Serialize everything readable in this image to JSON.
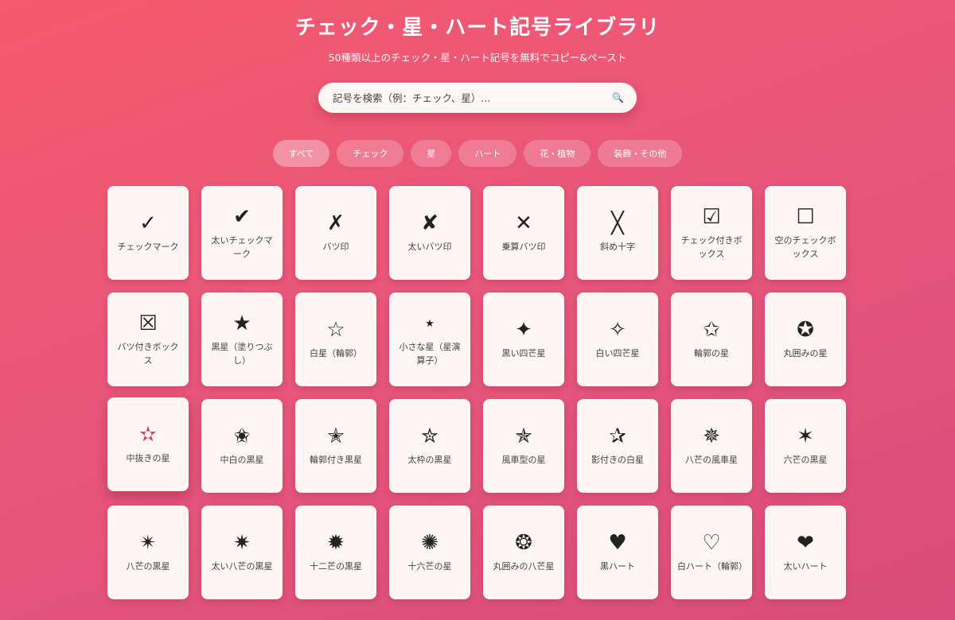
{
  "header": {
    "title": "チェック・星・ハート記号ライブラリ",
    "subtitle": "50種類以上のチェック・星・ハート記号を無料でコピー&ペースト"
  },
  "search": {
    "placeholder": "記号を検索（例：チェック、星）...",
    "icon": "search-icon"
  },
  "filters": [
    {
      "label": "すべて",
      "active": true
    },
    {
      "label": "チェック"
    },
    {
      "label": "星"
    },
    {
      "label": "ハート"
    },
    {
      "label": "花・植物"
    },
    {
      "label": "装飾・その他"
    }
  ],
  "symbols": [
    {
      "symbol": "✓",
      "name": "チェックマーク"
    },
    {
      "symbol": "✔",
      "name": "太いチェックマーク"
    },
    {
      "symbol": "✗",
      "name": "バツ印"
    },
    {
      "symbol": "✘",
      "name": "太いバツ印"
    },
    {
      "symbol": "✕",
      "name": "乗算バツ印"
    },
    {
      "symbol": "╳",
      "name": "斜め十字"
    },
    {
      "symbol": "☑",
      "name": "チェック付きボックス"
    },
    {
      "symbol": "☐",
      "name": "空のチェックボックス"
    },
    {
      "symbol": "☒",
      "name": "バツ付きボックス"
    },
    {
      "symbol": "★",
      "name": "黒星（塗りつぶし）"
    },
    {
      "symbol": "☆",
      "name": "白星（輪郭）"
    },
    {
      "symbol": "⋆",
      "name": "小さな星（星演算子）"
    },
    {
      "symbol": "✦",
      "name": "黒い四芒星"
    },
    {
      "symbol": "✧",
      "name": "白い四芒星"
    },
    {
      "symbol": "✩",
      "name": "輪郭の星"
    },
    {
      "symbol": "✪",
      "name": "丸囲みの星"
    },
    {
      "symbol": "✫",
      "name": "中抜きの星"
    },
    {
      "symbol": "✬",
      "name": "中白の黒星"
    },
    {
      "symbol": "✭",
      "name": "輪郭付き黒星"
    },
    {
      "symbol": "✮",
      "name": "太枠の黒星"
    },
    {
      "symbol": "✯",
      "name": "風車型の星"
    },
    {
      "symbol": "✰",
      "name": "影付きの白星"
    },
    {
      "symbol": "✵",
      "name": "八芒の風車星"
    },
    {
      "symbol": "✶",
      "name": "六芒の黒星"
    },
    {
      "symbol": "✴",
      "name": "八芒の黒星"
    },
    {
      "symbol": "✷",
      "name": "太い八芒の黒星"
    },
    {
      "symbol": "✹",
      "name": "十二芒の黒星"
    },
    {
      "symbol": "✺",
      "name": "十六芒の星"
    },
    {
      "symbol": "❂",
      "name": "丸囲みの八芒星"
    },
    {
      "symbol": "♥",
      "name": "黒ハート"
    },
    {
      "symbol": "♡",
      "name": "白ハート（輪郭）"
    },
    {
      "symbol": "❤",
      "name": "太いハート"
    }
  ],
  "selected_index": 16
}
